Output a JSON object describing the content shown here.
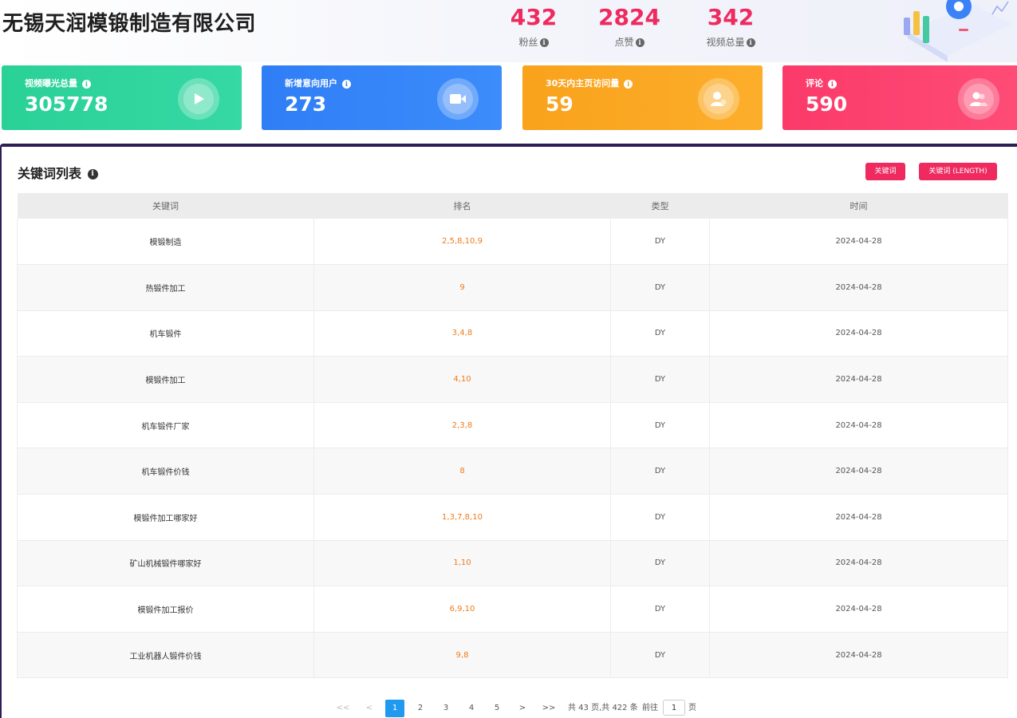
{
  "header": {
    "company": "无锡天润模锻制造有限公司",
    "stats": [
      {
        "value": "432",
        "label": "粉丝"
      },
      {
        "value": "2824",
        "label": "点赞"
      },
      {
        "value": "342",
        "label": "视频总量"
      }
    ]
  },
  "cards": [
    {
      "title": "视频曝光总量",
      "value": "305778",
      "icon": "play-icon",
      "color": "#2ad197"
    },
    {
      "title": "新增意向用户",
      "value": "273",
      "icon": "video-camera-icon",
      "color": "#2f7ef6"
    },
    {
      "title": "30天内主页访问量",
      "value": "59",
      "icon": "user-heart-icon",
      "color": "#f9a21c"
    },
    {
      "title": "评论",
      "value": "590",
      "icon": "users-icon",
      "color": "#fb3a6a"
    }
  ],
  "panel": {
    "title": "关键词列表",
    "buttons": [
      "关键词",
      "关键词 (LENGTH)"
    ],
    "columns": [
      "关键词",
      "排名",
      "类型",
      "时间"
    ],
    "rows": [
      {
        "keyword": "模锻制造",
        "rank": "2,5,8,10,9",
        "type": "DY",
        "time": "2024-04-28"
      },
      {
        "keyword": "热锻件加工",
        "rank": "9",
        "type": "DY",
        "time": "2024-04-28"
      },
      {
        "keyword": "机车锻件",
        "rank": "3,4,8",
        "type": "DY",
        "time": "2024-04-28"
      },
      {
        "keyword": "模锻件加工",
        "rank": "4,10",
        "type": "DY",
        "time": "2024-04-28"
      },
      {
        "keyword": "机车锻件厂家",
        "rank": "2,3,8",
        "type": "DY",
        "time": "2024-04-28"
      },
      {
        "keyword": "机车锻件价钱",
        "rank": "8",
        "type": "DY",
        "time": "2024-04-28"
      },
      {
        "keyword": "模锻件加工哪家好",
        "rank": "1,3,7,8,10",
        "type": "DY",
        "time": "2024-04-28"
      },
      {
        "keyword": "矿山机械锻件哪家好",
        "rank": "1,10",
        "type": "DY",
        "time": "2024-04-28"
      },
      {
        "keyword": "模锻件加工报价",
        "rank": "6,9,10",
        "type": "DY",
        "time": "2024-04-28"
      },
      {
        "keyword": "工业机器人锻件价钱",
        "rank": "9,8",
        "type": "DY",
        "time": "2024-04-28"
      }
    ]
  },
  "pager": {
    "first": "<<",
    "prev": "<",
    "pages": [
      "1",
      "2",
      "3",
      "4",
      "5"
    ],
    "current": "1",
    "next": ">",
    "last": ">>",
    "summary": "共 43 页,共 422 条",
    "goto_label": "前往",
    "goto_value": "1",
    "goto_suffix": "页"
  },
  "colors": {
    "accent": "#ee2a5f",
    "rank": "#f07a1a",
    "pager_active": "#1f9aef",
    "panel_border": "#2e1d55"
  }
}
